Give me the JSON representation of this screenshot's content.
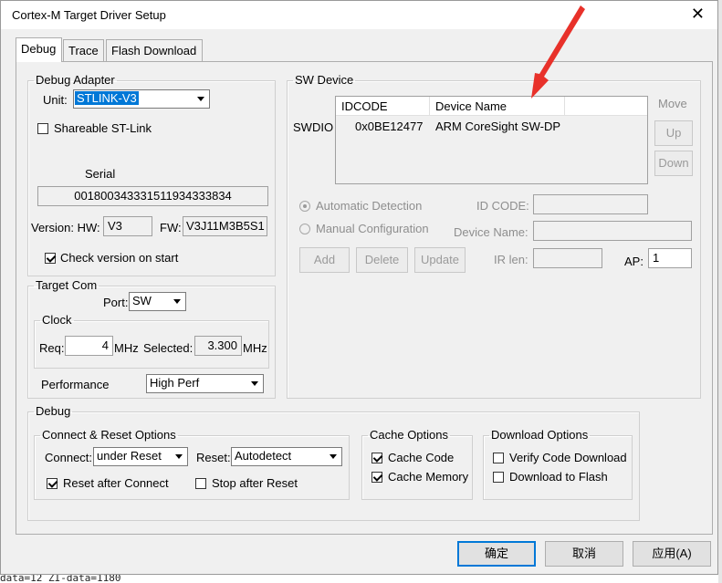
{
  "window": {
    "title": "Cortex-M Target Driver Setup",
    "close_glyph": "✕"
  },
  "tabs": [
    {
      "label": "Debug",
      "active": true
    },
    {
      "label": "Trace",
      "active": false
    },
    {
      "label": "Flash Download",
      "active": false
    }
  ],
  "debug_adapter": {
    "legend": "Debug Adapter",
    "unit_label": "Unit:",
    "unit_value": "STLINK-V3",
    "shareable_label": "Shareable ST-Link",
    "shareable_checked": false,
    "serial_label": "Serial",
    "serial_value": "001800343331511934333834",
    "version_label": "Version: HW:",
    "hw_value": "V3",
    "fw_label": "FW:",
    "fw_value": "V3J11M3B5S1",
    "check_version_label": "Check version on start",
    "check_version_checked": true
  },
  "target_com": {
    "legend": "Target Com",
    "port_label": "Port:",
    "port_value": "SW",
    "clock_legend": "Clock",
    "req_label": "Req:",
    "req_value": "4",
    "req_unit": "MHz",
    "selected_label": "Selected:",
    "selected_value": "3.300",
    "selected_unit": "MHz",
    "performance_label": "Performance",
    "performance_value": "High Perf"
  },
  "sw_device": {
    "legend": "SW Device",
    "swdio_label": "SWDIO",
    "columns": [
      "IDCODE",
      "Device Name"
    ],
    "rows": [
      {
        "idcode": "0x0BE12477",
        "device_name": "ARM CoreSight SW-DP"
      }
    ],
    "move_label": "Move",
    "up_label": "Up",
    "down_label": "Down",
    "auto_detect_label": "Automatic Detection",
    "manual_config_label": "Manual Configuration",
    "id_code_label": "ID CODE:",
    "device_name_label": "Device Name:",
    "add_label": "Add",
    "delete_label": "Delete",
    "update_label": "Update",
    "ir_len_label": "IR len:",
    "ap_label": "AP:",
    "ap_value": "1"
  },
  "debug_section": {
    "legend": "Debug",
    "connect_reset": {
      "legend": "Connect & Reset Options",
      "connect_label": "Connect:",
      "connect_value": "under Reset",
      "reset_label": "Reset:",
      "reset_value": "Autodetect",
      "reset_after_connect_label": "Reset after Connect",
      "reset_after_connect_checked": true,
      "stop_after_reset_label": "Stop after Reset",
      "stop_after_reset_checked": false
    },
    "cache": {
      "legend": "Cache Options",
      "cache_code_label": "Cache Code",
      "cache_memory_label": "Cache Memory"
    },
    "download": {
      "legend": "Download Options",
      "verify_label": "Verify Code Download",
      "download_flash_label": "Download to Flash"
    }
  },
  "footer": {
    "ok_label": "确定",
    "cancel_label": "取消",
    "help_label": "应用(A)"
  },
  "background_text": "data=12 ZI-data=1180",
  "colors": {
    "selection": "#0078d7",
    "annotation_arrow": "#e8312a"
  }
}
